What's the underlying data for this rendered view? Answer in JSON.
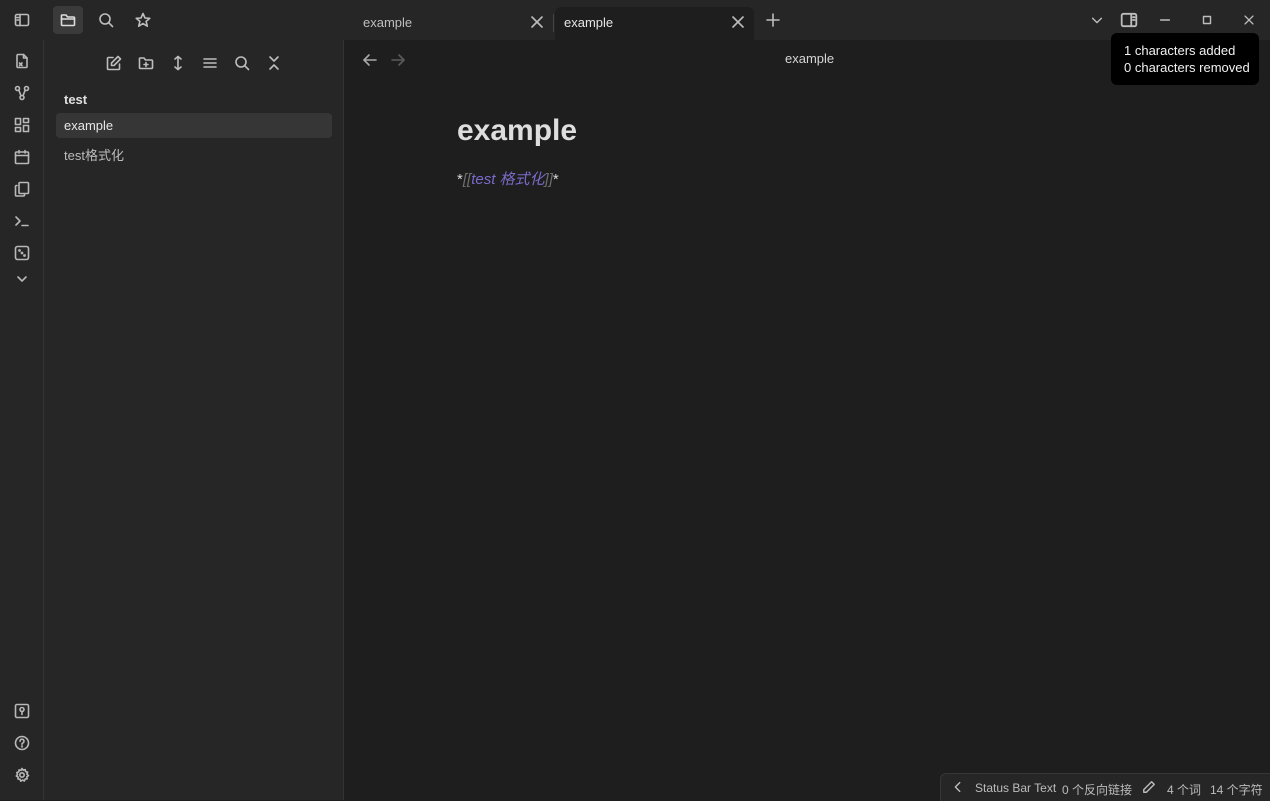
{
  "titlebar": {
    "left_icons": [
      {
        "name": "sidebar-toggle-icon"
      },
      {
        "name": "folder-icon"
      },
      {
        "name": "search-icon"
      },
      {
        "name": "star-icon"
      }
    ],
    "tabs": [
      {
        "label": "example",
        "active": false
      },
      {
        "label": "example",
        "active": true
      }
    ],
    "new_tab_icon": "plus-icon",
    "right_icons": [
      "chevron-down-icon",
      "split-view-icon",
      "minimize-icon",
      "maximize-icon",
      "close-icon"
    ]
  },
  "ribbon": {
    "items": [
      "switcher-icon",
      "graph-icon",
      "canvas-icon",
      "calendar-icon",
      "copy-icon",
      "terminal-icon",
      "dice-icon",
      "chevron-down-icon"
    ],
    "bottom": [
      "vault-icon",
      "help-icon",
      "settings-icon"
    ]
  },
  "sidebar": {
    "tools": [
      "new-note-icon",
      "new-folder-icon",
      "sort-icon",
      "list-icon",
      "search-icon",
      "collapse-icon"
    ],
    "folder": "test",
    "files": [
      {
        "label": "example",
        "active": true
      },
      {
        "label": "test格式化",
        "active": false
      }
    ]
  },
  "editor": {
    "view_title": "example",
    "heading": "example",
    "body": {
      "prefix": "*",
      "open": "[[",
      "link": "test 格式化",
      "close": "]]",
      "suffix": "*"
    }
  },
  "tooltip": {
    "line1": "1 characters added",
    "line2": "0 characters removed"
  },
  "statusbar": {
    "custom_text": "Status Bar Text",
    "backlinks": "0 个反向链接",
    "words": "4 个词",
    "chars": "14 个字符"
  },
  "colors": {
    "background": "#1e1e1e",
    "sidebar": "#262626",
    "accent_link": "#7a6bc9"
  }
}
